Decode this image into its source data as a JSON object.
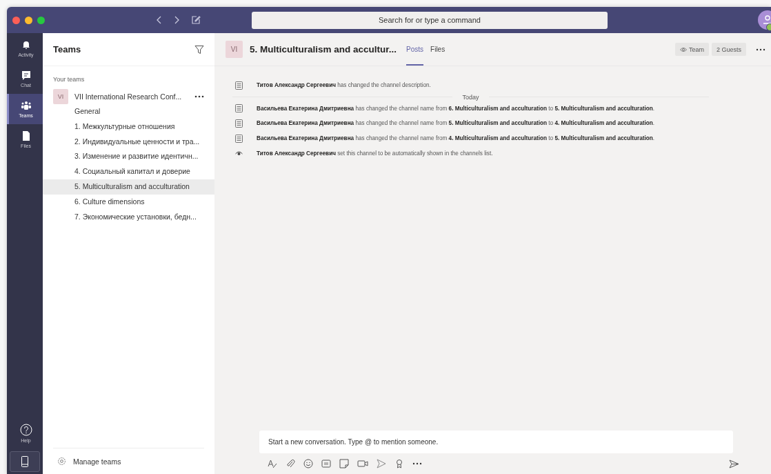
{
  "titlebar": {
    "search": {
      "placeholder": "Search for or type a command"
    }
  },
  "rail": {
    "items": [
      {
        "label": "Activity",
        "selected": false
      },
      {
        "label": "Chat",
        "selected": false
      },
      {
        "label": "Teams",
        "selected": true
      },
      {
        "label": "Files",
        "selected": false
      }
    ],
    "help": {
      "label": "Help"
    }
  },
  "teams_panel": {
    "title": "Teams",
    "section": "Your teams",
    "team": {
      "initials": "VI",
      "name": "VII International Research Conf...",
      "channels": [
        {
          "name": "General",
          "selected": false
        },
        {
          "name": "1. Межкультурные отношения",
          "selected": false
        },
        {
          "name": "2. Индивидуальные ценности и тра...",
          "selected": false
        },
        {
          "name": "3. Изменение и развитие идентичн...",
          "selected": false
        },
        {
          "name": "4. Социальный капитал и доверие",
          "selected": false
        },
        {
          "name": "5. Multiculturalism and acculturation",
          "selected": true
        },
        {
          "name": "6. Culture dimensions",
          "selected": false
        },
        {
          "name": "7. Экономические установки, бедн...",
          "selected": false
        }
      ]
    },
    "manage": "Manage teams"
  },
  "channel_header": {
    "initials": "VI",
    "title": "5. Multiculturalism and accultur...",
    "tabs": [
      {
        "label": "Posts",
        "selected": true
      },
      {
        "label": "Files",
        "selected": false
      }
    ],
    "buttons": [
      {
        "label": "Team",
        "kind": "eye"
      },
      {
        "label": "2 Guests",
        "kind": "plain"
      }
    ]
  },
  "feed": [
    {
      "kind": "change",
      "text": "**Титов Александр Сергеевич** has changed the channel description."
    },
    {
      "kind": "divider",
      "text": "Today"
    },
    {
      "kind": "change",
      "text": "**Васильева Екатерина Дмитриевна** has changed the channel name from **6. Multiculturalism and acculturation** to **5. Multiculturalism and acculturation**."
    },
    {
      "kind": "change",
      "text": "**Васильева Екатерина Дмитриевна** has changed the channel name from **5. Multiculturalism and acculturation** to **4. Multiculturalism and acculturation**."
    },
    {
      "kind": "change",
      "text": "**Васильева Екатерина Дмитриевна** has changed the channel name from **4. Multiculturalism and acculturation** to **5. Multiculturalism and acculturation**."
    },
    {
      "kind": "visibility",
      "text": "**Титов Александр Сергеевич** set this channel to be automatically shown in the channels list."
    }
  ],
  "compose": {
    "placeholder": "Start a new conversation. Type @ to mention someone."
  }
}
